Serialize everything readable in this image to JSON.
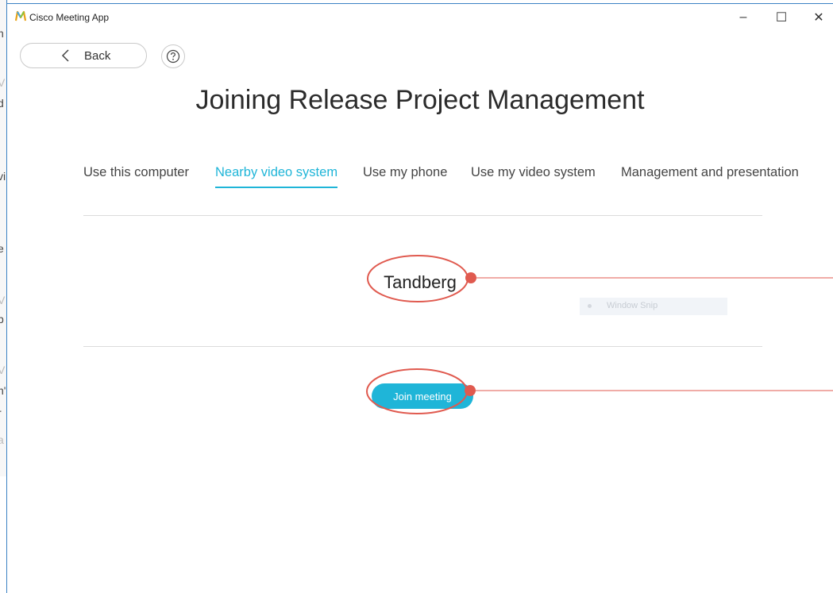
{
  "window": {
    "title": "Cisco Meeting App",
    "controls": {
      "minimize": "–",
      "maximize": "☐",
      "close": "✕"
    }
  },
  "nav": {
    "back_label": "Back"
  },
  "heading": "Joining Release Project Management",
  "tabs": [
    {
      "label": "Use this computer",
      "active": false
    },
    {
      "label": "Nearby video system",
      "active": true
    },
    {
      "label": "Use my phone",
      "active": false
    },
    {
      "label": "Use my video system",
      "active": false
    },
    {
      "label": "Management and presentation",
      "active": false
    }
  ],
  "device_name": "Tandberg",
  "join_button": "Join meeting",
  "ghost_snip_label": "Window Snip",
  "colors": {
    "accent": "#1fb5d8",
    "annotation": "#e05a4f",
    "window_border": "#3b82c4"
  }
}
